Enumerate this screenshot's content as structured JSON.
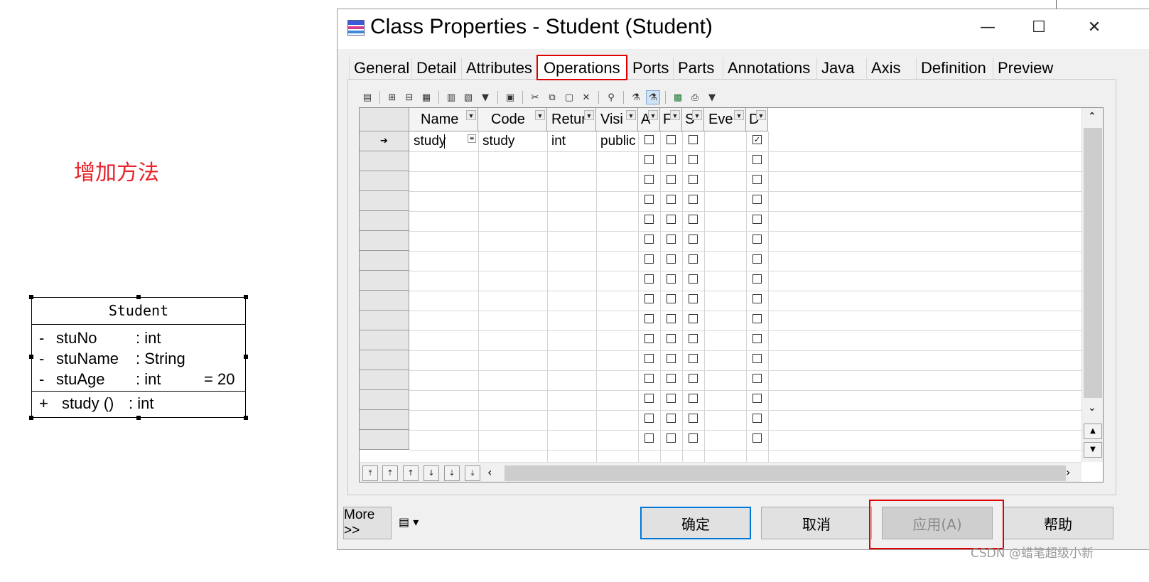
{
  "annotation": "增加方法",
  "uml": {
    "class_name": "Student",
    "attributes": [
      {
        "vis": "-",
        "name": "stuNo",
        "type": ": int",
        "initial": ""
      },
      {
        "vis": "-",
        "name": "stuName",
        "type": ": String",
        "initial": ""
      },
      {
        "vis": "-",
        "name": "stuAge",
        "type": ": int",
        "initial": "= 20"
      }
    ],
    "operations": [
      {
        "vis": "+",
        "name": "study ()",
        "type": ": int"
      }
    ]
  },
  "dialog": {
    "title": "Class Properties - Student (Student)",
    "window_buttons": {
      "minimize": "—",
      "maximize": "☐",
      "close": "✕"
    },
    "tabs": [
      "General",
      "Detail",
      "Attributes",
      "Operations",
      "Ports",
      "Parts",
      "Annotations",
      "Java",
      "Axis",
      "Definition",
      "Preview"
    ],
    "active_tab": "Operations",
    "grid": {
      "columns": [
        "Name",
        "Code",
        "Retur",
        "Visi",
        "A",
        "F",
        "S",
        "Eve",
        "D"
      ],
      "rows": [
        {
          "marker": "➔",
          "name": "study",
          "code": "study",
          "return": "int",
          "visibility": "public",
          "a": false,
          "f": false,
          "s": false,
          "event": "",
          "d": true
        }
      ],
      "empty_rows": 16
    },
    "buttons": {
      "more": "More >>",
      "ok": "确定",
      "cancel": "取消",
      "apply": "应用(A)",
      "help": "帮助"
    }
  },
  "watermark": "CSDN @蜡笔超级小新"
}
